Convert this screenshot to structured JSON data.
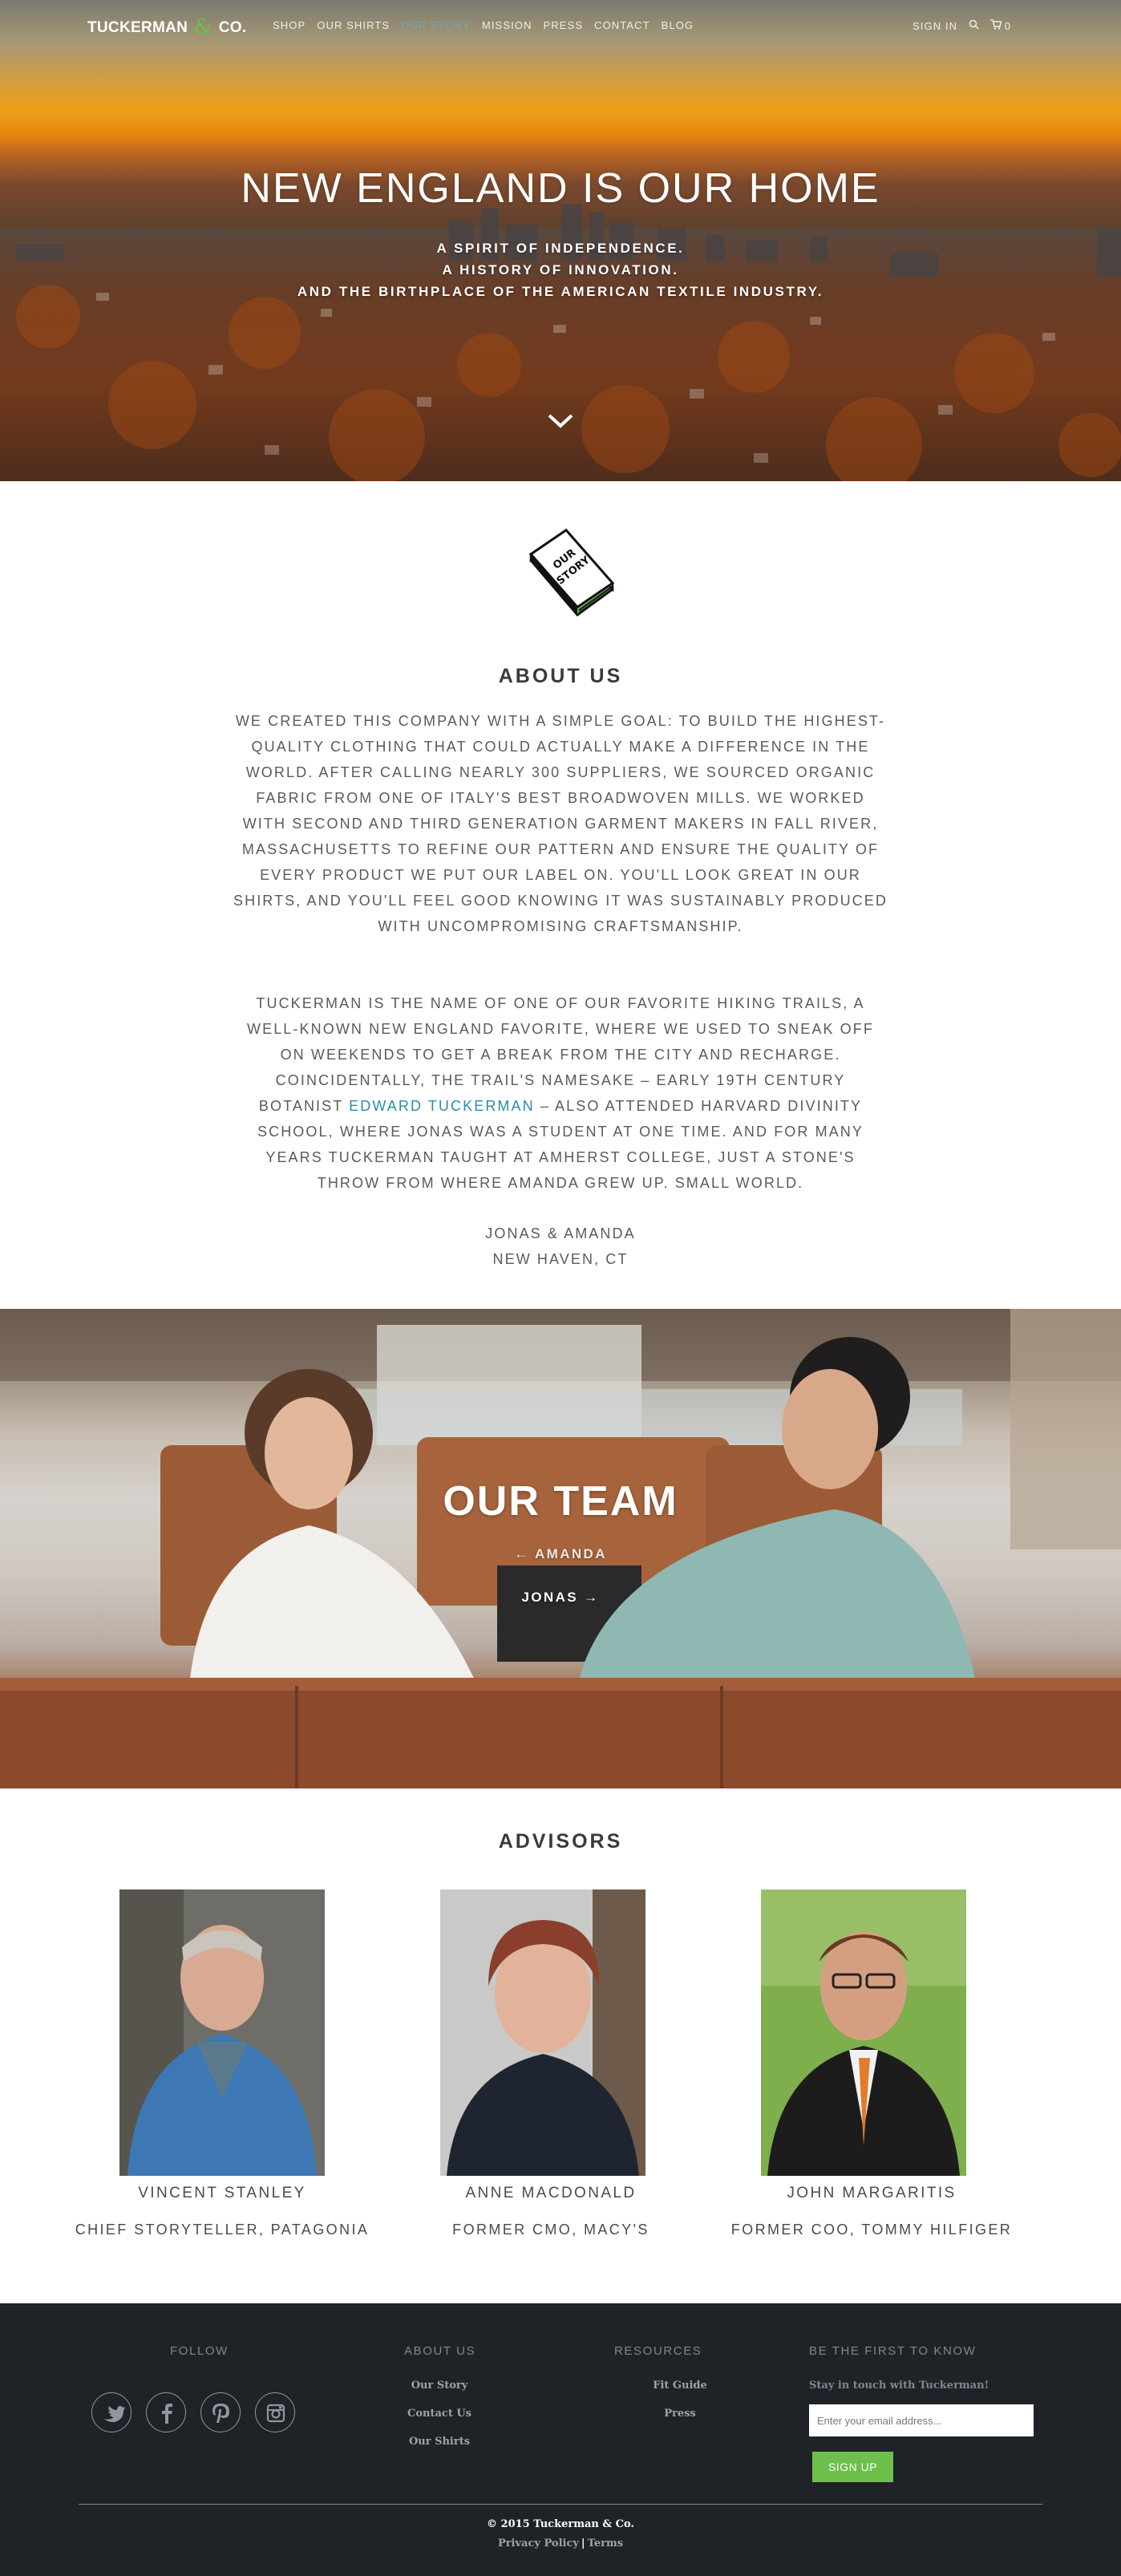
{
  "brand": {
    "name": "TUCKERMAN",
    "amp": "&",
    "suffix": "CO.",
    "accent_color": "#6cc04a",
    "link_color": "#2a8da8"
  },
  "nav": {
    "items": [
      {
        "label": "SHOP",
        "active": false
      },
      {
        "label": "OUR SHIRTS",
        "active": false
      },
      {
        "label": "OUR STORY",
        "active": true
      },
      {
        "label": "MISSION",
        "active": false
      },
      {
        "label": "PRESS",
        "active": false
      },
      {
        "label": "CONTACT",
        "active": false
      },
      {
        "label": "BLOG",
        "active": false
      }
    ],
    "sign_in": "SIGN IN",
    "search_icon": "search-icon",
    "cart_icon": "cart-icon",
    "cart_count": "0"
  },
  "hero": {
    "title": "NEW ENGLAND IS OUR HOME",
    "lines": [
      "A SPIRIT OF INDEPENDENCE.",
      "A HISTORY OF INNOVATION.",
      "AND THE BIRTHPLACE OF THE AMERICAN TEXTILE INDUSTRY."
    ],
    "scroll_icon": "chevron-down-icon"
  },
  "about": {
    "icon": "our-story-book-icon",
    "icon_text": "OUR STORY",
    "heading": "ABOUT US",
    "paragraph1": "WE CREATED THIS COMPANY WITH A SIMPLE GOAL: TO BUILD THE HIGHEST-QUALITY CLOTHING THAT COULD ACTUALLY MAKE A DIFFERENCE IN THE WORLD. AFTER CALLING NEARLY 300 SUPPLIERS, WE SOURCED ORGANIC FABRIC FROM ONE OF ITALY'S BEST BROADWOVEN MILLS. WE WORKED WITH SECOND AND THIRD GENERATION GARMENT MAKERS IN FALL RIVER, MASSACHUSETTS TO REFINE OUR PATTERN AND ENSURE THE QUALITY OF EVERY PRODUCT WE PUT OUR LABEL ON. YOU'LL LOOK GREAT IN OUR SHIRTS, AND YOU'LL FEEL GOOD KNOWING IT WAS SUSTAINABLY PRODUCED WITH UNCOMPROMISING CRAFTSMANSHIP.",
    "paragraph2_before": "TUCKERMAN IS THE NAME OF ONE OF OUR FAVORITE HIKING TRAILS, A WELL-KNOWN NEW ENGLAND FAVORITE, WHERE WE USED TO SNEAK OFF ON WEEKENDS TO GET A BREAK FROM THE CITY AND RECHARGE. COINCIDENTALLY, THE TRAIL'S NAMESAKE – EARLY 19TH CENTURY BOTANIST ",
    "paragraph2_link": "EDWARD TUCKERMAN",
    "paragraph2_after": " – ALSO ATTENDED HARVARD DIVINITY SCHOOL, WHERE JONAS WAS A STUDENT AT ONE TIME. AND FOR MANY YEARS TUCKERMAN TAUGHT AT AMHERST COLLEGE, JUST A STONE'S THROW FROM WHERE AMANDA GREW UP. SMALL WORLD.",
    "signature": "JONAS & AMANDA",
    "location": "NEW HAVEN, CT"
  },
  "team": {
    "title": "OUR TEAM",
    "link_left": "← AMANDA",
    "link_right": "JONAS →"
  },
  "advisors": {
    "heading": "ADVISORS",
    "people": [
      {
        "name": "VINCENT STANLEY",
        "role": "CHIEF STORYTELLER, PATAGONIA"
      },
      {
        "name": "ANNE MACDONALD",
        "role": "FORMER CMO, MACY'S"
      },
      {
        "name": "JOHN MARGARITIS",
        "role": "FORMER COO, TOMMY HILFIGER"
      }
    ]
  },
  "footer": {
    "follow_heading": "FOLLOW",
    "social": [
      "twitter-icon",
      "facebook-icon",
      "pinterest-icon",
      "instagram-icon"
    ],
    "about_heading": "ABOUT US",
    "about_links": [
      "Our Story",
      "Contact Us",
      "Our Shirts"
    ],
    "resources_heading": "RESOURCES",
    "resources_links": [
      "Fit Guide",
      "Press"
    ],
    "newsletter_heading": "BE THE FIRST TO KNOW",
    "newsletter_note": "Stay in touch with Tuckerman!",
    "email_placeholder": "Enter your email address...",
    "signup_label": "SIGN UP",
    "copyright": "© 2015 Tuckerman & Co.",
    "privacy": "Privacy Policy",
    "separator": "|",
    "terms": "Terms"
  }
}
